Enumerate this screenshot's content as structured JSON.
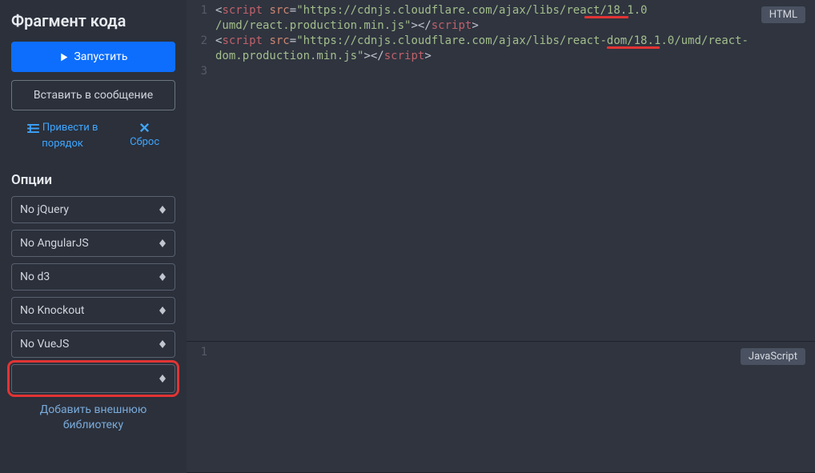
{
  "sidebar": {
    "title": "Фрагмент кода",
    "run_label": "Запустить",
    "insert_label": "Вставить в сообщение",
    "tidy_label": "Привести в\nпорядок",
    "reset_label": "Сброс",
    "options_title": "Опции",
    "selects": [
      {
        "value": "No jQuery"
      },
      {
        "value": "No AngularJS"
      },
      {
        "value": "No d3"
      },
      {
        "value": "No Knockout"
      },
      {
        "value": "No VueJS"
      },
      {
        "value": ""
      }
    ],
    "add_library_label": "Добавить внешнюю\nбиблиотеку"
  },
  "editor": {
    "html_badge": "HTML",
    "js_badge": "JavaScript",
    "html_lines": {
      "l1a": "<",
      "l1b": "script",
      "l1c": " ",
      "l1d": "src",
      "l1e": "=",
      "l1f": "\"https://cdnjs.cloudflare.com/ajax/libs/react/18.1.0",
      "l2a": "/umd/react.production.min.js\"",
      "l2b": "></",
      "l2c": "script",
      "l2d": ">",
      "l3a": "<",
      "l3b": "script",
      "l3c": " ",
      "l3d": "src",
      "l3e": "=",
      "l3f": "\"https://cdnjs.cloudflare.com/ajax/libs/react-dom/18.1.0/umd/react-",
      "l4a": "dom.production.min.js\"",
      "l4b": "></",
      "l4c": "script",
      "l4d": ">"
    },
    "html_line_numbers": [
      "1",
      "2",
      "3"
    ],
    "js_line_numbers": [
      "1"
    ]
  }
}
